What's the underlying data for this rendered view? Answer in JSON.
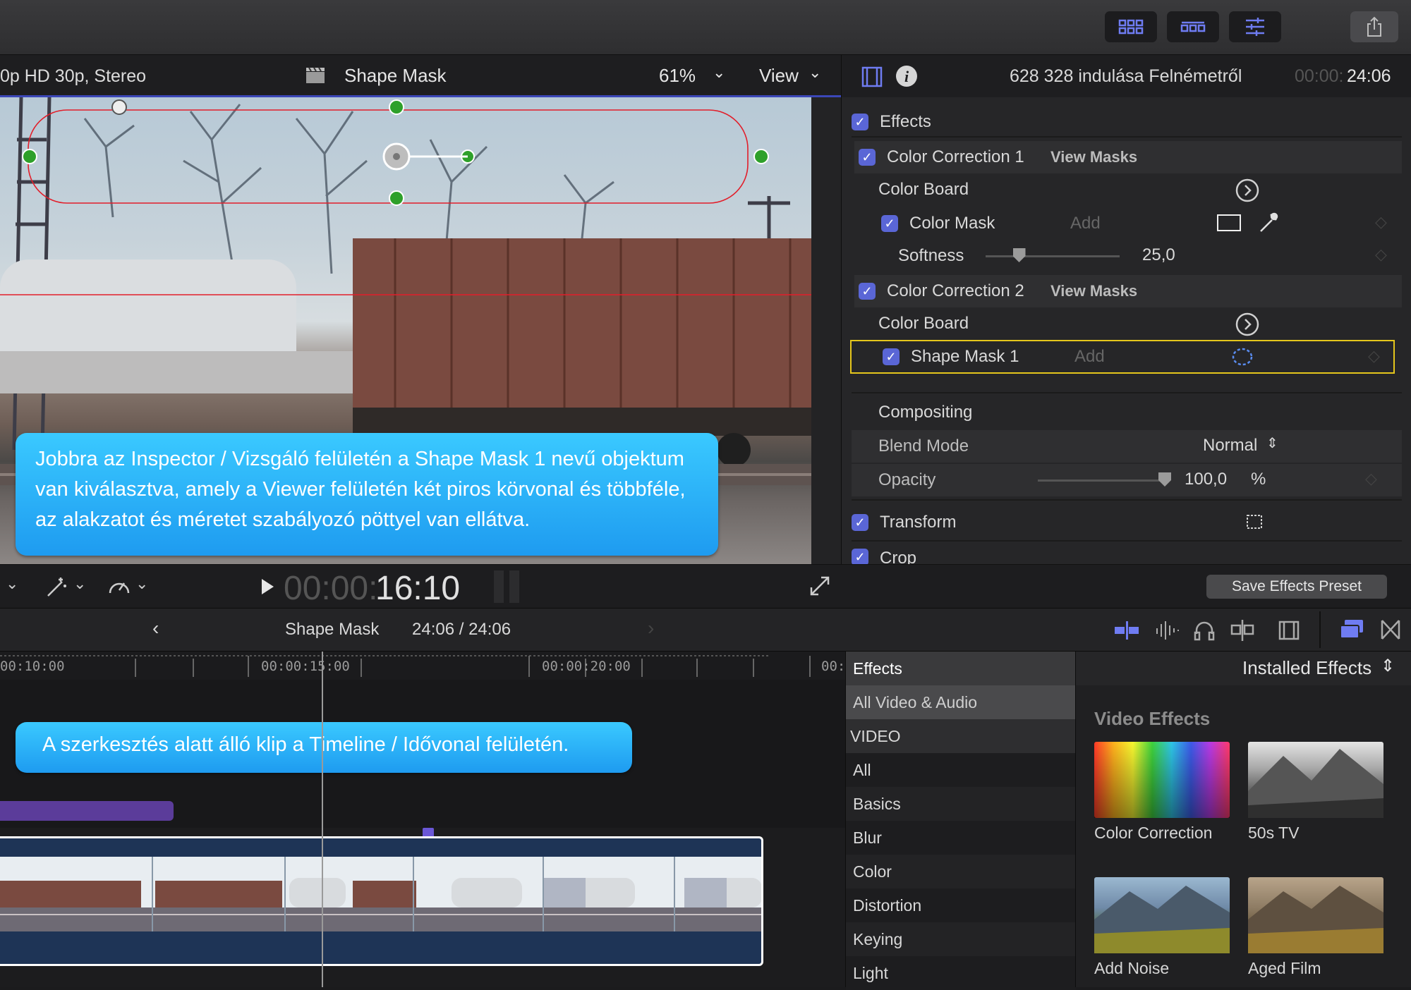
{
  "viewer": {
    "format": "0p HD 30p, Stereo",
    "title": "Shape Mask",
    "zoom": "61%",
    "view_label": "View",
    "timecode_dim": "00:00:",
    "timecode_bright": "16:10"
  },
  "inspector": {
    "clip_name": "628 328 indulása Felnémetről",
    "timecode_dim": "00:00:",
    "timecode_bright": "24:06",
    "rows": {
      "effects": "Effects",
      "cc1": "Color Correction 1",
      "cc1_view": "View Masks",
      "board1": "Color Board",
      "color_mask": "Color Mask",
      "add1": "Add",
      "softness": "Softness",
      "softness_value": "25,0",
      "cc2": "Color Correction 2",
      "cc2_view": "View Masks",
      "board2": "Color Board",
      "shape_mask": "Shape Mask 1",
      "add2": "Add",
      "compositing": "Compositing",
      "blend_mode": "Blend Mode",
      "blend_value": "Normal",
      "opacity": "Opacity",
      "opacity_value": "100,0",
      "opacity_unit": "%",
      "transform": "Transform",
      "crop": "Crop"
    },
    "softness_level": 0.25,
    "opacity_level": 1.0,
    "save_preset": "Save Effects Preset"
  },
  "callouts": {
    "viewer": "Jobbra az Inspector / Vizsgáló felületén a Shape Mask 1 nevű objektum van kiválasztva, amely a Viewer felületén két piros körvonal és többféle, az alakzatot és méretet szabályozó pöttyel van ellátva.",
    "timeline": "A szerkesztés alatt álló klip a Timeline / Idővonal felületén."
  },
  "timeline": {
    "project": "Shape Mask",
    "duration": "24:06 / 24:06",
    "ruler": [
      "00:10:00",
      "00:00:15:00",
      "00:00:20:00",
      "00:"
    ]
  },
  "effects_browser": {
    "header": "Effects",
    "installed": "Installed Effects",
    "categories": [
      "All Video & Audio",
      "VIDEO",
      "All",
      "Basics",
      "Blur",
      "Color",
      "Distortion",
      "Keying",
      "Light"
    ],
    "section": "Video Effects",
    "items": [
      "Color Correction",
      "50s TV",
      "Add Noise",
      "Aged Film"
    ]
  },
  "colors": {
    "accent": "#5a66d6",
    "highlight": "#e5c61c",
    "callout": "#2aaef5",
    "clip": "#1e3456",
    "purple": "#5b3c9a"
  }
}
